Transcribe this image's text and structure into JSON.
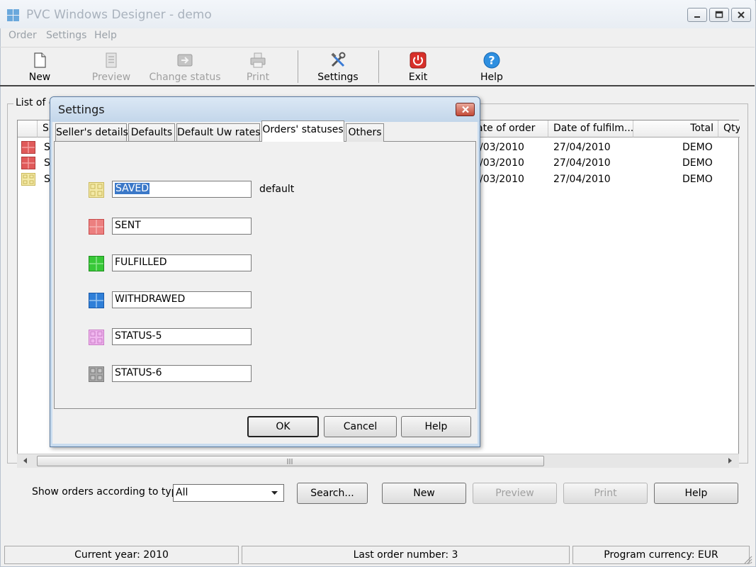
{
  "window": {
    "title": "PVC Windows Designer - demo"
  },
  "menu": [
    "Order",
    "Settings",
    "Help"
  ],
  "toolbar": [
    {
      "label": "New",
      "icon": "new-document-icon",
      "enabled": true
    },
    {
      "label": "Preview",
      "icon": "preview-icon",
      "enabled": false
    },
    {
      "label": "Change status",
      "icon": "change-status-icon",
      "enabled": false
    },
    {
      "label": "Print",
      "icon": "printer-icon",
      "enabled": false
    },
    {
      "label": "Settings",
      "icon": "tools-icon",
      "enabled": true
    },
    {
      "label": "Exit",
      "icon": "power-icon",
      "enabled": true
    },
    {
      "label": "Help",
      "icon": "question-icon",
      "enabled": true
    }
  ],
  "orders": {
    "group_label": "List of o",
    "columns": [
      "S",
      "ate of order",
      "Date of fulfilm...",
      "Total",
      "Qty"
    ],
    "rows": [
      {
        "status_color": "#e05a5a",
        "status": "S",
        "date_order": "/03/2010",
        "date_fulfilment": "27/04/2010",
        "total": "DEMO"
      },
      {
        "status_color": "#e05a5a",
        "status": "S",
        "date_order": "/03/2010",
        "date_fulfilment": "27/04/2010",
        "total": "DEMO"
      },
      {
        "status_color": "#e8d98a",
        "status": "S",
        "date_order": "/03/2010",
        "date_fulfilment": "27/04/2010",
        "total": "DEMO"
      }
    ]
  },
  "filter": {
    "label": "Show orders according to type",
    "value": "All"
  },
  "bottom_buttons": {
    "search": "Search...",
    "new": "New",
    "preview": "Preview",
    "print": "Print",
    "help": "Help"
  },
  "status_bar": {
    "year": "Current year: 2010",
    "last_order": "Last order number: 3",
    "currency": "Program currency: EUR"
  },
  "dialog": {
    "title": "Settings",
    "tabs": [
      "Seller's details",
      "Defaults",
      "Default Uw rates",
      "Orders' statuses",
      "Others"
    ],
    "active_tab": "Orders' statuses",
    "statuses": [
      {
        "name": "SAVED",
        "color": "#f3e9a6",
        "border": "#c9b75a",
        "selected": true
      },
      {
        "name": "SENT",
        "color": "#ec7f7f",
        "border": "#c74b4b"
      },
      {
        "name": "FULFILLED",
        "color": "#38c838",
        "border": "#1f8e1f"
      },
      {
        "name": "WITHDRAWED",
        "color": "#2f7fd8",
        "border": "#1b5aa8"
      },
      {
        "name": "STATUS-5",
        "color": "#f0b6ee",
        "border": "#c97ac6"
      },
      {
        "name": "STATUS-6",
        "color": "#a9a9a9",
        "border": "#7a7a7a"
      }
    ],
    "default_label": "default",
    "buttons": {
      "ok": "OK",
      "cancel": "Cancel",
      "help": "Help"
    }
  }
}
